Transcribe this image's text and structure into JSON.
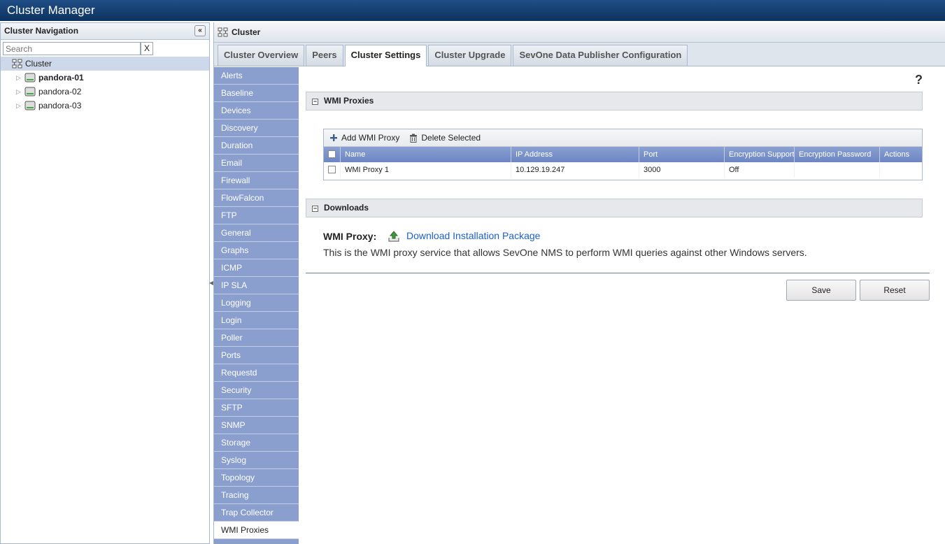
{
  "app": {
    "title": "Cluster Manager"
  },
  "nav": {
    "header": "Cluster Navigation",
    "collapse_label": "«",
    "search": {
      "placeholder": "Search",
      "value": "",
      "clear_label": "X"
    },
    "tree": {
      "root": "Cluster",
      "nodes": [
        {
          "label": "pandora-01"
        },
        {
          "label": "pandora-02"
        },
        {
          "label": "pandora-03"
        }
      ]
    }
  },
  "main": {
    "header": "Cluster",
    "tabs": [
      {
        "label": "Cluster Overview"
      },
      {
        "label": "Peers"
      },
      {
        "label": "Cluster Settings"
      },
      {
        "label": "Cluster Upgrade"
      },
      {
        "label": "SevOne Data Publisher Configuration"
      }
    ],
    "active_tab": "Cluster Settings"
  },
  "settings_menu": {
    "items": [
      "Alerts",
      "Baseline",
      "Devices",
      "Discovery",
      "Duration",
      "Email",
      "Firewall",
      "FlowFalcon",
      "FTP",
      "General",
      "Graphs",
      "ICMP",
      "IP SLA",
      "Logging",
      "Login",
      "Poller",
      "Ports",
      "Requestd",
      "Security",
      "SFTP",
      "SNMP",
      "Storage",
      "Syslog",
      "Topology",
      "Tracing",
      "Trap Collector",
      "WMI Proxies"
    ],
    "active": "WMI Proxies"
  },
  "content": {
    "help": "?",
    "wmi_section": {
      "title": "WMI Proxies",
      "toggle": "−"
    },
    "toolbar": {
      "add": "Add WMI Proxy",
      "delete": "Delete Selected"
    },
    "columns": [
      "Name",
      "IP Address",
      "Port",
      "Encryption Support",
      "Encryption Password",
      "Actions"
    ],
    "rows": [
      {
        "name": "WMI Proxy 1",
        "ip": "10.129.19.247",
        "port": "3000",
        "encryption_support": "Off",
        "encryption_password": "",
        "actions": ""
      }
    ],
    "downloads_section": {
      "title": "Downloads",
      "toggle": "−"
    },
    "download": {
      "label": "WMI Proxy:",
      "link": "Download Installation Package",
      "description": "This is the WMI proxy service that allows SevOne NMS to perform WMI queries against other Windows servers."
    },
    "buttons": {
      "save": "Save",
      "reset": "Reset"
    }
  },
  "colors": {
    "topbar": "#0d335f",
    "menu": "#8b9fcf",
    "grid_header": "#6c86c3",
    "link": "#1a5fcf"
  }
}
